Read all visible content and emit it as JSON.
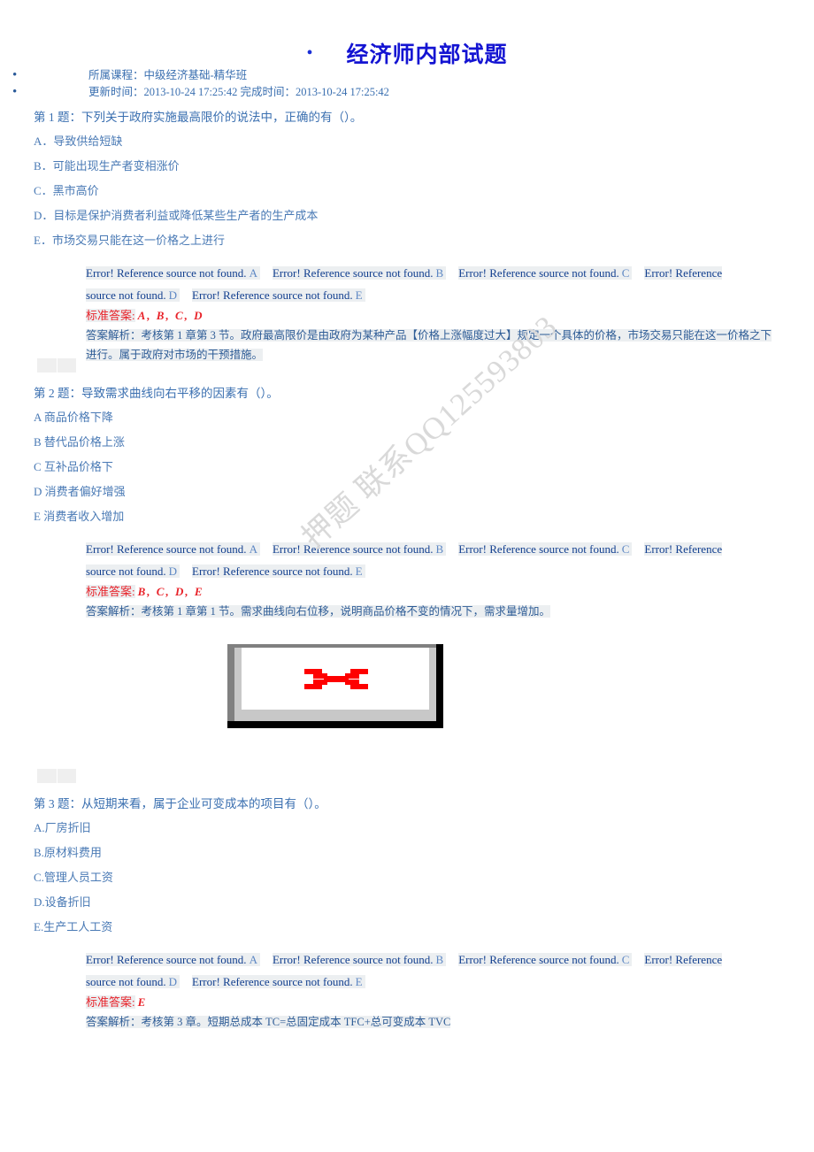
{
  "document": {
    "title": "经济师内部试题",
    "title_bullet": "•",
    "watermark": "押题 联系QQ125593803"
  },
  "meta": [
    {
      "bullet": "•",
      "text": "所属课程：中级经济基础-精华班"
    },
    {
      "bullet": "•",
      "text": "更新时间：2013-10-24 17:25:42 完成时间：2013-10-24 17:25:42"
    }
  ],
  "labels": {
    "error_ref": "Error! Reference source not found.",
    "std_answer_label": "标准答案:",
    "analysis_prefix": "答案解析："
  },
  "option_letters": [
    "A",
    "B",
    "C",
    "D",
    "E"
  ],
  "questions": [
    {
      "title": "第 1 题：下列关于政府实施最高限价的说法中，正确的有（）。",
      "options": [
        "A．导致供给短缺",
        "B．可能出现生产者变相涨价",
        "C．黑市高价",
        "D．目标是保护消费者利益或降低某些生产者的生产成本",
        "E．市场交易只能在这一价格之上进行"
      ],
      "standard_answer": "A, B, C, D",
      "analysis": "答案解析：考核第 1 章第 3 节。政府最高限价是由政府为某种产品【价格上涨幅度过大】规定一个具体的价格，市场交易只能在这一价格之下进行。属于政府对市场的干预措施。"
    },
    {
      "title": "第 2 题：导致需求曲线向右平移的因素有（）。",
      "options": [
        "A 商品价格下降",
        "B 替代品价格上涨",
        "C 互补品价格下",
        "D 消费者偏好增强",
        "E 消费者收入增加"
      ],
      "standard_answer": "B, C, D, E",
      "analysis": "答案解析：考核第 1 章第 1 节。需求曲线向右位移，说明商品价格不变的情况下，需求量增加。"
    },
    {
      "title": "第 3 题：从短期来看，属于企业可变成本的项目有（）。",
      "options": [
        "A.厂房折旧",
        "B.原材料费用",
        "C.管理人员工资",
        "D.设备折旧",
        "E.生产工人工资"
      ],
      "standard_answer": "E",
      "analysis": "答案解析：考核第 3 章。短期总成本 TC=总固定成本 TFC+总可变成本 TVC"
    }
  ],
  "broken_image": {
    "alt": "broken-image-placeholder"
  },
  "colors": {
    "title": "#1414d2",
    "body_text": "#3a6fb0",
    "answer_red": "#e8232a",
    "highlight": "#eceff1",
    "watermark": "#d9d9d9"
  }
}
